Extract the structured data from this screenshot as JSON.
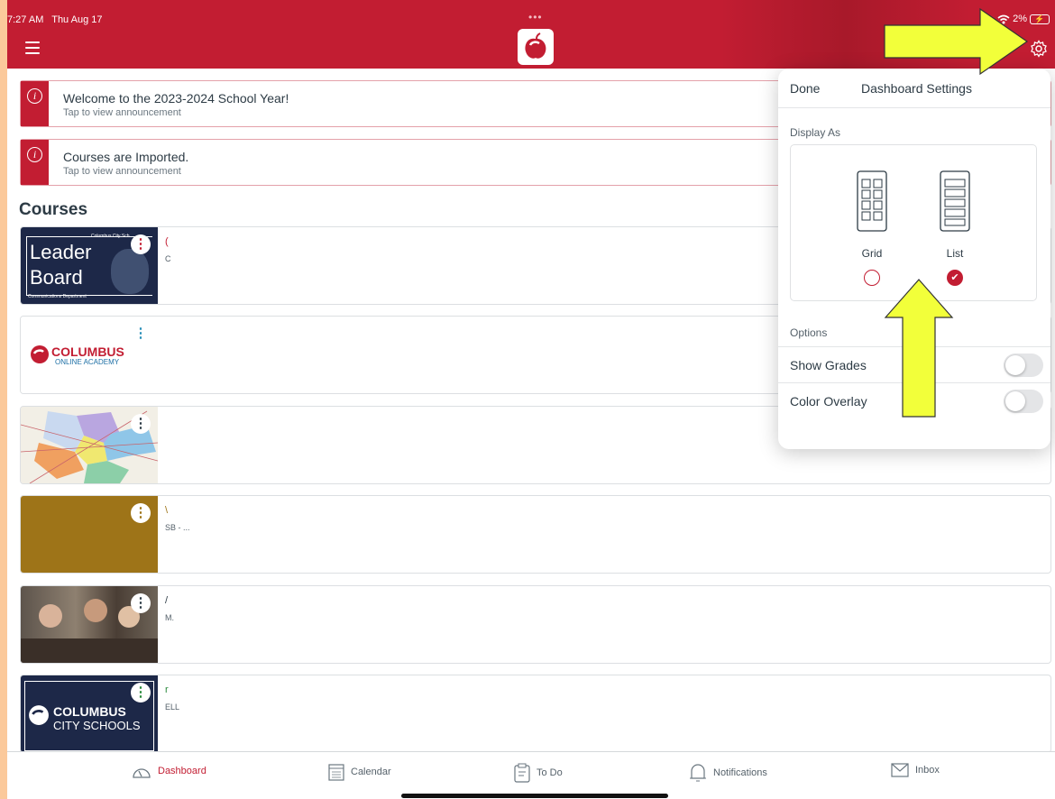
{
  "status_bar": {
    "time": "7:27 AM",
    "date": "Thu Aug 17",
    "battery": "2%",
    "dots": "•••"
  },
  "header": {
    "menu_icon": "hamburger-icon",
    "logo_icon": "apple-logo-icon",
    "settings_icon": "gear-icon"
  },
  "announcements": [
    {
      "title": "Welcome to the 2023-2024 School Year!",
      "subtitle": "Tap to view announcement",
      "icon": "info-icon"
    },
    {
      "title": "Courses are Imported.",
      "subtitle": "Tap to view announcement",
      "icon": "info-icon"
    }
  ],
  "courses_heading": "Courses",
  "courses_right_mark": "I",
  "courses": [
    {
      "thumb_line1": "Leader",
      "thumb_line2": "Board",
      "thumb_small": "Columbus City Sch",
      "thumb_caption": "Communications Department",
      "title": "(",
      "subtitle": "C",
      "kebab_color": "#c21d32",
      "title_color": "#c21d32"
    },
    {
      "thumb_line1": "COLUMBUS",
      "thumb_line2": "ONLINE ACADEMY",
      "title": "",
      "subtitle": "",
      "kebab_color": "#2a8fb8",
      "title_color": "#2a8fb8"
    },
    {
      "title": "",
      "subtitle": "",
      "kebab_color": "#2d3b45",
      "title_color": "#2d3b45"
    },
    {
      "title": "\\",
      "subtitle": "SB - ...",
      "kebab_color": "#9e7418",
      "title_color": "#9e7418"
    },
    {
      "title": "/",
      "subtitle": "M.",
      "kebab_color": "#2d3b45",
      "title_color": "#2d3b45"
    },
    {
      "thumb_line1": "COLUMBUS",
      "thumb_line2": "CITY SCHOOLS",
      "title": "r",
      "subtitle": "ELL",
      "kebab_color": "#2a8a3c",
      "title_color": "#2a8a3c"
    }
  ],
  "popover": {
    "done_label": "Done",
    "title": "Dashboard Settings",
    "display_as_label": "Display As",
    "grid_label": "Grid",
    "list_label": "List",
    "selected": "List",
    "options_label": "Options",
    "show_grades_label": "Show Grades",
    "show_grades_on": false,
    "color_overlay_label": "Color Overlay",
    "color_overlay_on": false
  },
  "bottom_nav": [
    {
      "label": "Dashboard",
      "icon": "dashboard-icon",
      "active": true
    },
    {
      "label": "Calendar",
      "icon": "calendar-icon",
      "active": false
    },
    {
      "label": "To Do",
      "icon": "clipboard-icon",
      "active": false
    },
    {
      "label": "Notifications",
      "icon": "bell-icon",
      "active": false
    },
    {
      "label": "Inbox",
      "icon": "envelope-icon",
      "active": false
    }
  ],
  "colors": {
    "brand": "#c21d32",
    "annotation_arrow": "#f2ff3a",
    "background": "#fbc99b"
  }
}
